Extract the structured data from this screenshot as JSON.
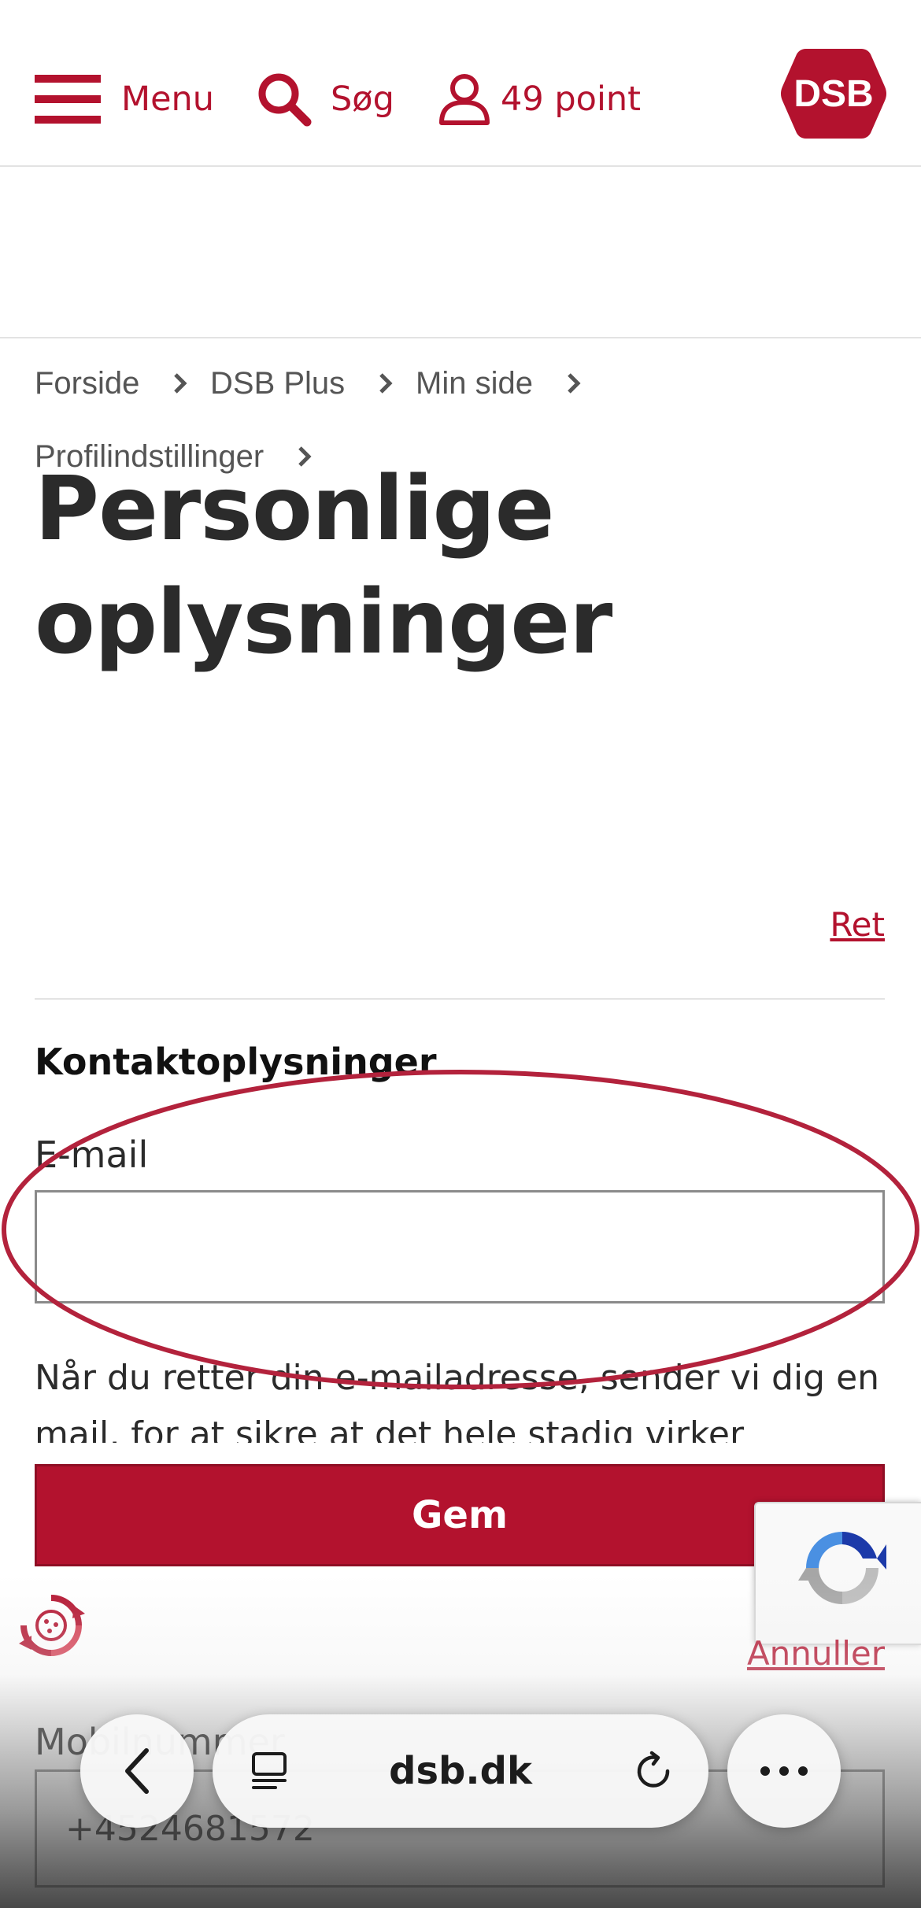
{
  "header": {
    "menu_label": "Menu",
    "search_label": "Søg",
    "points_label": "49 point",
    "logo_text": "DSB",
    "brand_color": "#b3122e"
  },
  "breadcrumb": {
    "items": [
      "Forside",
      "DSB Plus",
      "Min side",
      "Profilindstillinger"
    ]
  },
  "page": {
    "title_line1": "Personlige",
    "title_line2": "oplysninger",
    "edit_link": "Ret"
  },
  "contact": {
    "section_title": "Kontaktoplysninger",
    "email_label": "E-mail",
    "email_value": "",
    "help_text": "Når du retter din e-mailadresse, sender vi dig en mail, for at sikre at det hele stadig virker",
    "save_button": "Gem",
    "cancel_link": "Annuller",
    "mobile_label": "Mobilnummer",
    "mobile_value": "+4524681572"
  },
  "browser": {
    "url": "dsb.dk"
  },
  "icons": {
    "menu": "hamburger-icon",
    "search": "search-icon",
    "account": "user-icon",
    "breadcrumb_separator": "chevron-right-icon",
    "recaptcha": "recaptcha-icon",
    "cookie": "cookie-settings-icon",
    "back": "chevron-left-icon",
    "tabs": "tabs-icon",
    "reload": "reload-icon",
    "more": "more-icon"
  },
  "annotation_color": "#b3223c"
}
